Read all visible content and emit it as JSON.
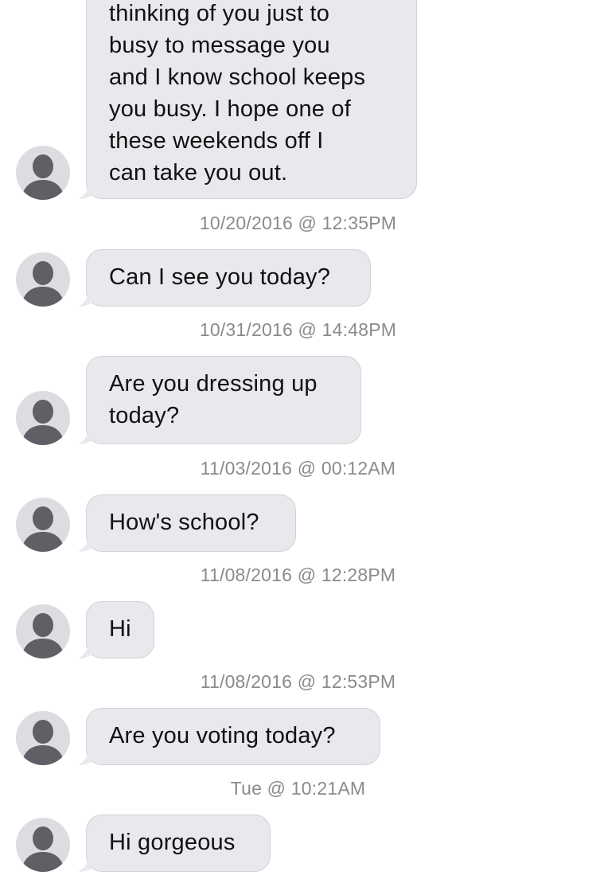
{
  "conversation": {
    "messages": [
      {
        "text": "thinking of you just to\nbusy to message you\nand I know school keeps\nyou busy. I hope one of\nthese weekends off I\ncan take you out."
      },
      {
        "timestamp": "10/20/2016 @ 12:35PM",
        "text": "Can I see you today?"
      },
      {
        "timestamp": "10/31/2016 @ 14:48PM",
        "text": "Are you dressing up\ntoday?"
      },
      {
        "timestamp": "11/03/2016 @ 00:12AM",
        "text": "How's school?"
      },
      {
        "timestamp": "11/08/2016 @ 12:28PM",
        "text": "Hi"
      },
      {
        "timestamp": "11/08/2016 @ 12:53PM",
        "text": "Are you voting today?"
      },
      {
        "timestamp": "Tue @ 10:21AM",
        "text": "Hi gorgeous"
      }
    ]
  },
  "colors": {
    "bubble": "#e8e8ed",
    "bubble_border": "#d2d2d8",
    "avatar_bg": "#dcdce1",
    "avatar_figure": "#5f5f66",
    "timestamp": "#8a8a8f",
    "text": "#111111"
  },
  "icons": {
    "avatar": "person-silhouette-icon"
  }
}
